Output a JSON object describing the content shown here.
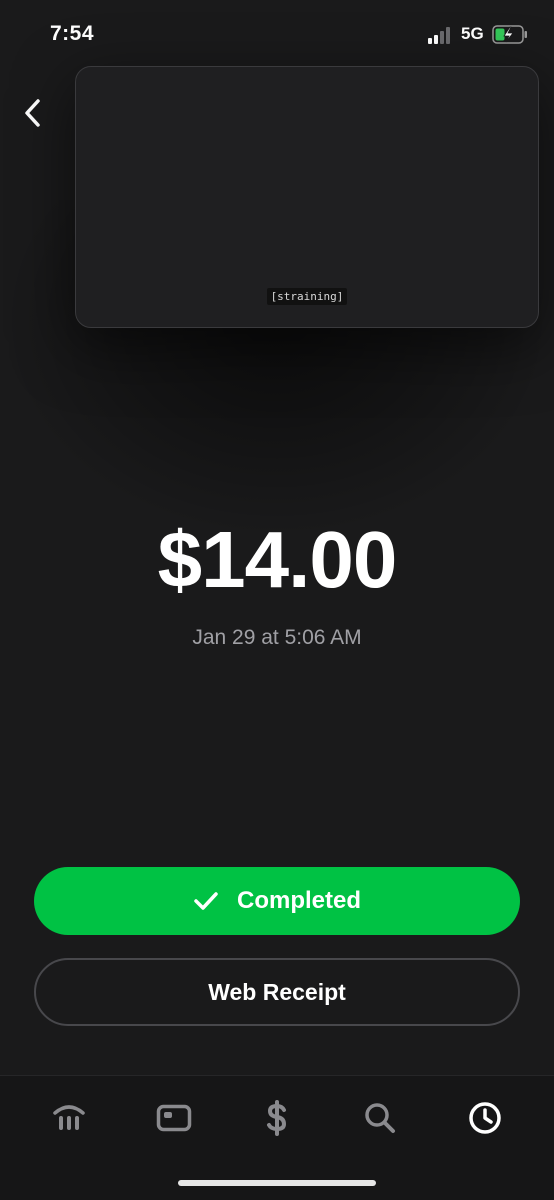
{
  "status_bar": {
    "time": "7:54",
    "network": "5G"
  },
  "media": {
    "caption": "[straining]"
  },
  "payment": {
    "amount": "$14.00",
    "date": "Jan 29 at 5:06 AM"
  },
  "actions": {
    "completed_label": "Completed",
    "receipt_label": "Web Receipt"
  },
  "colors": {
    "accent": "#00c244",
    "background": "#1a1a1b",
    "muted_text": "#a0a0a5"
  },
  "tab_bar": {
    "tabs": [
      {
        "icon": "bank-icon",
        "active": false
      },
      {
        "icon": "card-icon",
        "active": false
      },
      {
        "icon": "dollar-icon",
        "active": false
      },
      {
        "icon": "search-icon",
        "active": false
      },
      {
        "icon": "clock-icon",
        "active": true
      }
    ]
  }
}
